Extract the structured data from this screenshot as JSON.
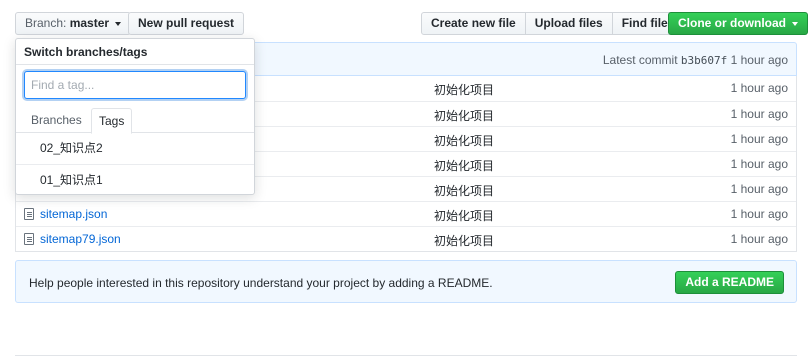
{
  "toolbar": {
    "branch_prefix": "Branch:",
    "branch_name": "master",
    "new_pr_label": "New pull request",
    "create_file_label": "Create new file",
    "upload_files_label": "Upload files",
    "find_file_label": "Find file",
    "clone_label": "Clone or download"
  },
  "commit_bar": {
    "prefix": "Latest commit",
    "sha": "b3b607f",
    "age": "1 hour ago"
  },
  "files": [
    {
      "name": "",
      "message": "初始化项目",
      "age": "1 hour ago"
    },
    {
      "name": "",
      "message": "初始化项目",
      "age": "1 hour ago"
    },
    {
      "name": "",
      "message": "初始化项目",
      "age": "1 hour ago"
    },
    {
      "name": "",
      "message": "初始化项目",
      "age": "1 hour ago"
    },
    {
      "name": "",
      "message": "初始化项目",
      "age": "1 hour ago"
    },
    {
      "name": "sitemap.json",
      "message": "初始化项目",
      "age": "1 hour ago"
    },
    {
      "name": "sitemap79.json",
      "message": "初始化项目",
      "age": "1 hour ago"
    }
  ],
  "readme_banner": {
    "text": "Help people interested in this repository understand your project by adding a README.",
    "button_label": "Add a README"
  },
  "dropdown": {
    "title": "Switch branches/tags",
    "filter_placeholder": "Find a tag...",
    "tab_branches": "Branches",
    "tab_tags": "Tags",
    "tags": [
      "02_知识点2",
      "01_知识点1"
    ]
  },
  "colors": {
    "link": "#0366d6",
    "primary_green": "#28a745",
    "info_bg": "#f1f8ff"
  }
}
